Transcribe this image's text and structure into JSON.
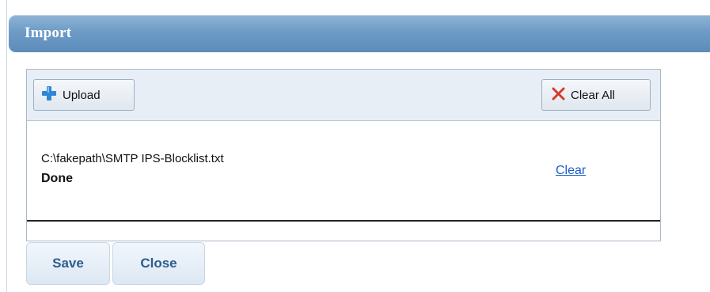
{
  "dialog": {
    "title": "Import"
  },
  "toolbar": {
    "upload_label": "Upload",
    "upload_icon": "plus-icon",
    "clear_all_label": "Clear All",
    "clear_all_icon": "x-icon"
  },
  "files": [
    {
      "path": "C:\\fakepath\\SMTP IPS-Blocklist.txt",
      "status": "Done",
      "action": "Clear"
    }
  ],
  "footer": {
    "save_label": "Save",
    "close_label": "Close"
  },
  "colors": {
    "title_bar": "#6e9bc6",
    "link": "#1b5fc4",
    "footer_button_text": "#2c5d8f",
    "plus_icon": "#2f86d6",
    "x_icon": "#d43a2b"
  }
}
